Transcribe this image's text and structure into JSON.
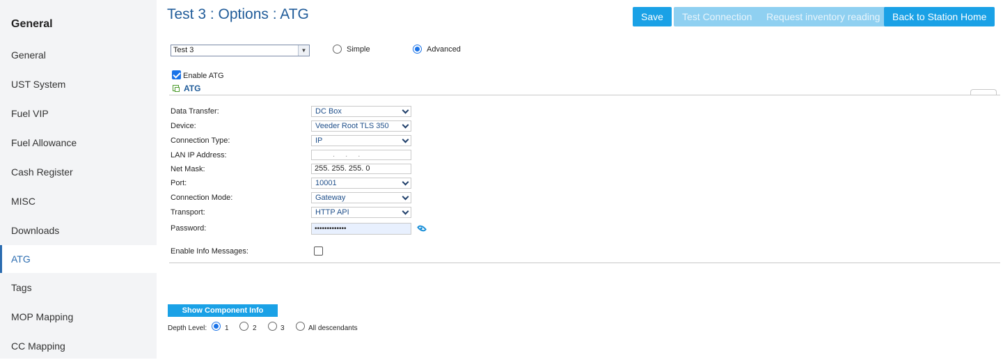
{
  "sidebar": {
    "heading": "General",
    "items": [
      {
        "label": "General"
      },
      {
        "label": "UST System"
      },
      {
        "label": "Fuel VIP"
      },
      {
        "label": "Fuel Allowance"
      },
      {
        "label": "Cash Register"
      },
      {
        "label": "MISC"
      },
      {
        "label": "Downloads"
      },
      {
        "label": "ATG",
        "active": true
      },
      {
        "label": "Tags"
      },
      {
        "label": "MOP Mapping"
      },
      {
        "label": "CC Mapping"
      }
    ]
  },
  "header": {
    "title": "Test 3 : Options : ATG",
    "buttons": {
      "save": "Save",
      "test_connection": "Test Connection",
      "request_inventory": "Request inventory reading",
      "back_home": "Back to Station Home"
    }
  },
  "station_select": {
    "value": "Test 3"
  },
  "mode": {
    "simple": "Simple",
    "advanced": "Advanced",
    "selected": "Advanced"
  },
  "enable_atg": {
    "label": "Enable ATG",
    "checked": true
  },
  "section_title": "ATG",
  "fields": {
    "data_transfer": {
      "label": "Data Transfer:",
      "value": "DC Box"
    },
    "device": {
      "label": "Device:",
      "value": "Veeder Root TLS 350"
    },
    "connection_type": {
      "label": "Connection Type:",
      "value": "IP"
    },
    "lan_ip": {
      "label": "LAN IP Address:",
      "value": ". . ."
    },
    "net_mask": {
      "label": "Net Mask:",
      "value": "255. 255. 255.   0"
    },
    "port": {
      "label": "Port:",
      "value": "10001"
    },
    "connection_mode": {
      "label": "Connection Mode:",
      "value": "Gateway"
    },
    "transport": {
      "label": "Transport:",
      "value": "HTTP API"
    },
    "password": {
      "label": "Password:",
      "value": "•••••••••••••"
    },
    "enable_info": {
      "label": "Enable Info Messages:",
      "checked": false
    }
  },
  "component_info": {
    "button": "Show Component Info",
    "depth_label": "Depth Level:",
    "options": [
      "1",
      "2",
      "3",
      "All descendants"
    ],
    "selected": "1"
  },
  "colors": {
    "accent": "#1aa1e6",
    "title": "#1f5b99",
    "sidebar_bg": "#f3f4f6"
  }
}
